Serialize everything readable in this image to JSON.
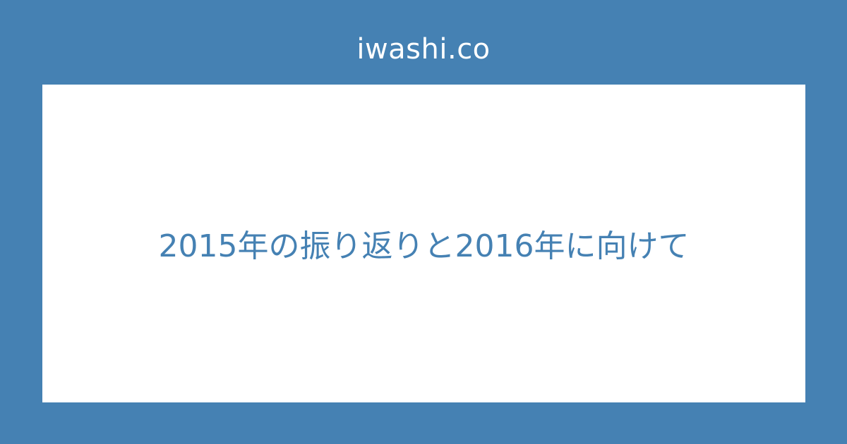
{
  "header": {
    "site_name": "iwashi.co"
  },
  "card": {
    "title": "2015年の振り返りと2016年に向けて"
  },
  "colors": {
    "background": "#4581b3",
    "card": "#ffffff",
    "title_text": "#4581b3",
    "site_name_text": "#ffffff"
  }
}
